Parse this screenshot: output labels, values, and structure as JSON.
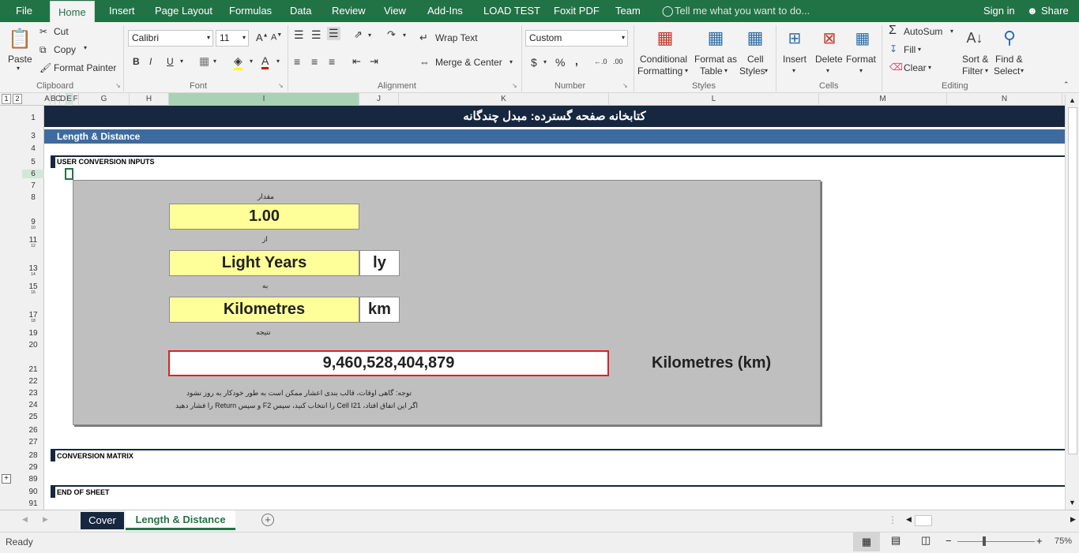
{
  "menu": {
    "file": "File",
    "home": "Home",
    "insert": "Insert",
    "page_layout": "Page Layout",
    "formulas": "Formulas",
    "data": "Data",
    "review": "Review",
    "view": "View",
    "addins": "Add-Ins",
    "load_test": "LOAD TEST",
    "foxit": "Foxit PDF",
    "team": "Team",
    "tell_me": "Tell me what you want to do...",
    "sign_in": "Sign in",
    "share": "Share"
  },
  "ribbon": {
    "clipboard": {
      "paste": "Paste",
      "cut": "Cut",
      "copy": "Copy",
      "format_painter": "Format Painter",
      "label": "Clipboard"
    },
    "font": {
      "name": "Calibri",
      "size": "11",
      "bold": "B",
      "italic": "I",
      "underline": "U",
      "label": "Font"
    },
    "alignment": {
      "wrap_text": "Wrap Text",
      "merge_center": "Merge & Center",
      "label": "Alignment"
    },
    "number": {
      "format": "Custom",
      "currency": "$",
      "percent": "%",
      "comma": ",",
      "label": "Number"
    },
    "styles": {
      "conditional_1": "Conditional",
      "conditional_2": "Formatting",
      "format_table_1": "Format as",
      "format_table_2": "Table",
      "cell_styles_1": "Cell",
      "cell_styles_2": "Styles",
      "label": "Styles"
    },
    "cells": {
      "insert": "Insert",
      "delete": "Delete",
      "format": "Format",
      "label": "Cells"
    },
    "editing": {
      "autosum": "AutoSum",
      "fill": "Fill",
      "clear": "Clear",
      "sort_1": "Sort &",
      "sort_2": "Filter",
      "find_1": "Find &",
      "find_2": "Select",
      "label": "Editing"
    }
  },
  "columns": [
    "A",
    "B",
    "C",
    "D",
    "E",
    "F",
    "G",
    "H",
    "I",
    "J",
    "K",
    "L",
    "M",
    "N"
  ],
  "outline_levels": [
    "1",
    "2"
  ],
  "rows": [
    "1",
    "3",
    "4",
    "5",
    "6",
    "7",
    "8",
    "9",
    "10",
    "11",
    "12",
    "13",
    "14",
    "15",
    "16",
    "17",
    "18",
    "19",
    "20",
    "21",
    "22",
    "23",
    "24",
    "25",
    "26",
    "27",
    "28",
    "29",
    "89",
    "90",
    "91"
  ],
  "sheet": {
    "title": "کتابخانه صفحه گسترده:  مبدل چندگانه",
    "section_title": "Length & Distance",
    "user_inputs_header": "USER CONVERSION INPUTS",
    "amount_label": "مقدار",
    "amount_value": "1.00",
    "from_label": "از",
    "from_unit": "Light Years",
    "from_abbr": "ly",
    "to_label": "به",
    "to_unit": "Kilometres",
    "to_abbr": "km",
    "result_label": "نتیجه",
    "result_value": "9,460,528,404,879",
    "result_unit": "Kilometres (km)",
    "note_line1": "توجه: گاهی اوقات، قالب بندی اعشار ممکن است به طور خودکار به روز نشود",
    "note_line2": "اگر این اتفاق افتاد، Cell I21 را انتخاب کنید، سپس F2 و سپس Return را فشار دهید",
    "matrix_header": "CONVERSION MATRIX",
    "end_header": "END OF SHEET"
  },
  "sheet_tabs": [
    "Cover",
    "Length & Distance"
  ],
  "status": {
    "ready": "Ready",
    "zoom": "75%"
  },
  "colors": {
    "excel_green": "#217346",
    "title_bar": "#16273f",
    "section_bar": "#3e6b9f",
    "input_yellow": "#ffff99",
    "panel_grey": "#bfbfbf",
    "result_border": "#e02020"
  }
}
